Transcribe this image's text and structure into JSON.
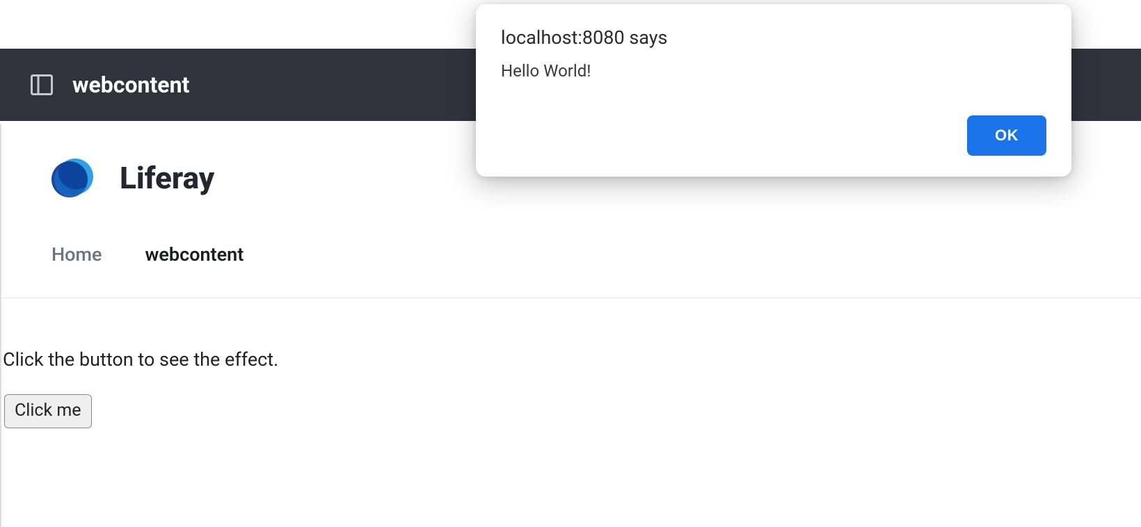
{
  "topbar": {
    "title": "webcontent"
  },
  "brand": {
    "name": "Liferay"
  },
  "nav": {
    "home_label": "Home",
    "current_label": "webcontent"
  },
  "content": {
    "instruction": "Click the button to see the effect.",
    "button_label": "Click me"
  },
  "alert": {
    "title": "localhost:8080 says",
    "message": "Hello World!",
    "ok_label": "OK"
  }
}
